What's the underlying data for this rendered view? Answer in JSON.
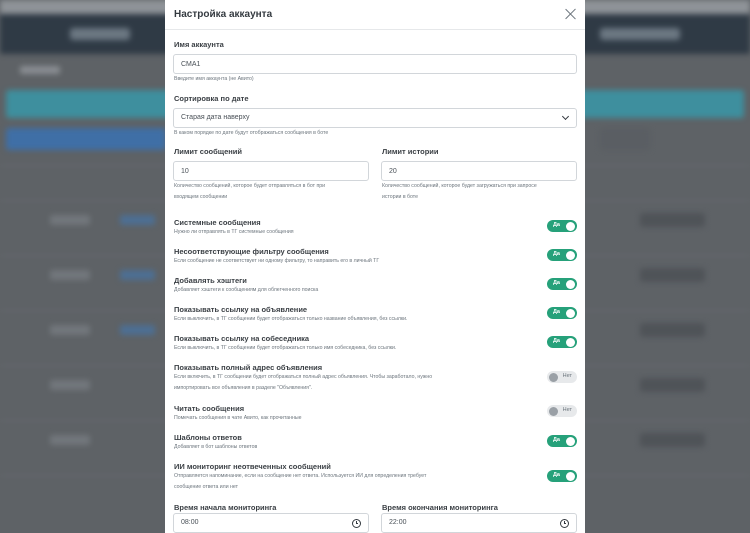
{
  "modal": {
    "title": "Настройка аккаунта",
    "account_name": {
      "label": "Имя аккаунта",
      "value": "CMA1",
      "hint": "Введите имя аккаунта (не Авито)"
    },
    "sort": {
      "label": "Сортировка по дате",
      "selected": "Старая дата наверху",
      "hint": "В каком порядке по дате будут отображаться сообщения в боте"
    },
    "message_limit": {
      "label": "Лимит сообщений",
      "value": "10",
      "hint_line1": "Количество сообщений, которое будет отправляться в бот при",
      "hint_line2": "входящем сообщении"
    },
    "history_limit": {
      "label": "Лимит истории",
      "value": "20",
      "hint_line1": "Количество сообщений, которое будет загружаться при запросе",
      "hint_line2": "истории в боте"
    },
    "toggles": [
      {
        "label": "Системные сообщения",
        "hint1": "Нужно ли отправлять в ТГ системные сообщения",
        "hint2": "",
        "state": "Да",
        "on": true
      },
      {
        "label": "Несоответствующие фильтру сообщения",
        "hint1": "Если сообщение не соответствует ни одному фильтру, то направить его в личный ТГ",
        "hint2": "",
        "state": "Да",
        "on": true
      },
      {
        "label": "Добавлять хэштеги",
        "hint1": "Добавляет хэштеги к сообщениям для облегченного поиска",
        "hint2": "",
        "state": "Да",
        "on": true
      },
      {
        "label": "Показывать ссылку на объявление",
        "hint1": "Если выключить, в ТГ сообщении будет отображаться только название объявления, без ссылки.",
        "hint2": "",
        "state": "Да",
        "on": true
      },
      {
        "label": "Показывать ссылку на собеседника",
        "hint1": "Если выключить, в ТГ сообщении будет отображаться только имя собеседника, без ссылки.",
        "hint2": "",
        "state": "Да",
        "on": true
      },
      {
        "label": "Показывать полный адрес объявления",
        "hint1": "Если включить, в ТГ сообщении будет отображаться полный адрес объявления. Чтобы заработало, нужно",
        "hint2": "импортировать все объявления в разделе \"Объявления\".",
        "state": "Нет",
        "on": false
      },
      {
        "label": "Читать сообщения",
        "hint1": "Помечать сообщения в чате Авито, как прочитанные",
        "hint2": "",
        "state": "Нет",
        "on": false
      },
      {
        "label": "Шаблоны ответов",
        "hint1": "Добавляет в бот шаблоны ответов",
        "hint2": "",
        "state": "Да",
        "on": true
      },
      {
        "label": "ИИ мониторинг неотвеченных сообщений",
        "hint1": "Отправляется напоминание, если на сообщение нет ответа. Используется ИИ для определения требует",
        "hint2": "сообщение ответа или нет",
        "state": "Да",
        "on": true
      }
    ],
    "monitor_start": {
      "label": "Время начала мониторинга",
      "value": "08:00"
    },
    "monitor_end": {
      "label": "Время окончания мониторинга",
      "value": "22:00"
    }
  }
}
